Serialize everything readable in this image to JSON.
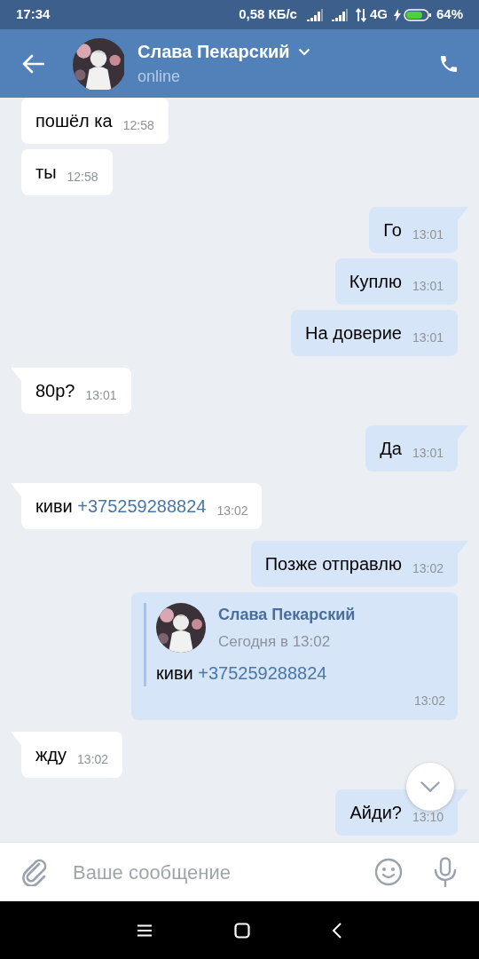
{
  "status_bar": {
    "time": "17:34",
    "speed": "0,58 КБ/с",
    "network": "4G",
    "battery": "64%"
  },
  "header": {
    "name": "Слава Пекарский",
    "status": "online"
  },
  "messages": [
    {
      "kind": "text",
      "outgoing": false,
      "tail": false,
      "text": "пошёл ка",
      "time": "12:58"
    },
    {
      "kind": "text",
      "outgoing": false,
      "tail": false,
      "text": "ты",
      "time": "12:58"
    },
    {
      "kind": "text",
      "outgoing": true,
      "tail": true,
      "text": "Го",
      "time": "13:01"
    },
    {
      "kind": "text",
      "outgoing": true,
      "tail": false,
      "text": "Куплю",
      "time": "13:01"
    },
    {
      "kind": "text",
      "outgoing": true,
      "tail": false,
      "text": "На доверие",
      "time": "13:01"
    },
    {
      "kind": "text",
      "outgoing": false,
      "tail": true,
      "text": "80р?",
      "time": "13:01"
    },
    {
      "kind": "text",
      "outgoing": true,
      "tail": true,
      "text": "Да",
      "time": "13:01"
    },
    {
      "kind": "text",
      "outgoing": false,
      "tail": true,
      "text": "киви",
      "link": "+375259288824",
      "time": "13:02"
    },
    {
      "kind": "text",
      "outgoing": true,
      "tail": true,
      "text": "Позже отправлю",
      "time": "13:02"
    },
    {
      "kind": "forward",
      "outgoing": true,
      "tail": false,
      "author": "Слава Пекарский",
      "date": "Сегодня в 13:02",
      "text": "киви",
      "link": "+375259288824",
      "time": "13:02"
    },
    {
      "kind": "text",
      "outgoing": false,
      "tail": true,
      "text": "жду",
      "time": "13:02"
    },
    {
      "kind": "text",
      "outgoing": true,
      "tail": true,
      "text": "Айди?",
      "time": "13:10"
    }
  ],
  "composer": {
    "placeholder": "Ваше сообщение"
  }
}
